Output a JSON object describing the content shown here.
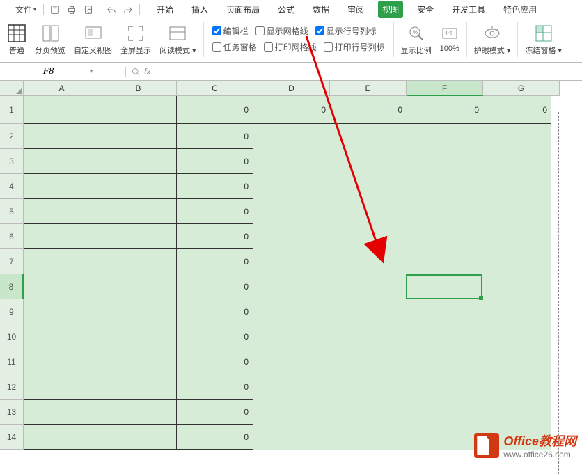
{
  "menubar": {
    "file_menu": "文件",
    "tabs": [
      "开始",
      "插入",
      "页面布局",
      "公式",
      "数据",
      "审阅",
      "视图",
      "安全",
      "开发工具",
      "特色应用"
    ],
    "active_tab": "视图"
  },
  "ribbon": {
    "normal": "普通",
    "page_preview": "分页预览",
    "custom_view": "自定义视图",
    "fullscreen": "全屏显示",
    "read_mode": "阅读模式",
    "checks": {
      "edit_bar": "编辑栏",
      "show_gridlines": "显示网格线",
      "show_headers": "显示行号列标",
      "task_pane": "任务窗格",
      "print_gridlines": "打印网格线",
      "print_headers": "打印行号列标"
    },
    "zoom": "显示比例",
    "hundred": "100%",
    "eye_mode": "护眼模式",
    "freeze": "冻结窗格"
  },
  "namebox": "F8",
  "fx_label": "fx",
  "columns": [
    "A",
    "B",
    "C",
    "D",
    "E",
    "F",
    "G"
  ],
  "rows": [
    "1",
    "2",
    "3",
    "4",
    "5",
    "6",
    "7",
    "8",
    "9",
    "10",
    "11",
    "12",
    "13",
    "14"
  ],
  "row1_values": [
    "",
    "",
    "0",
    "0",
    "0",
    "0",
    "0"
  ],
  "col_c_zeros": "0",
  "watermark": {
    "title": "Office教程网",
    "url": "www.office26.com"
  }
}
